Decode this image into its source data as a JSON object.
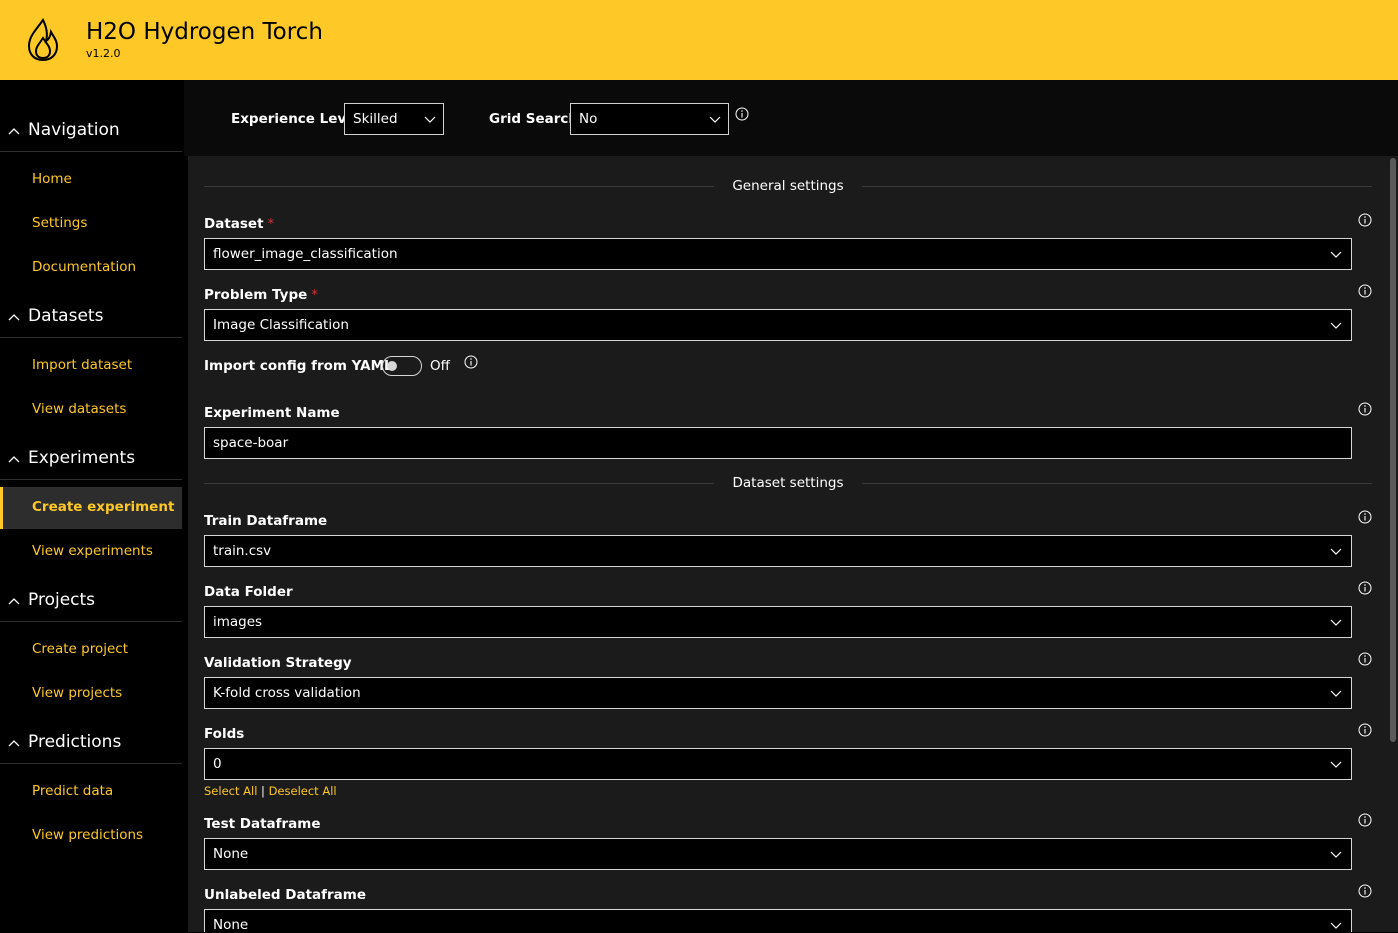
{
  "app": {
    "title": "H2O Hydrogen Torch",
    "version": "v1.2.0"
  },
  "colors": {
    "accent": "#fec827",
    "background": "#000000",
    "card": "#1b1b1b",
    "required": "#d13438"
  },
  "sidebar": {
    "groups": [
      {
        "label": "Navigation",
        "items": [
          "Home",
          "Settings",
          "Documentation"
        ]
      },
      {
        "label": "Datasets",
        "items": [
          "Import dataset",
          "View datasets"
        ]
      },
      {
        "label": "Experiments",
        "items": [
          "Create experiment",
          "View experiments"
        ]
      },
      {
        "label": "Projects",
        "items": [
          "Create project",
          "View projects"
        ]
      },
      {
        "label": "Predictions",
        "items": [
          "Predict data",
          "View predictions"
        ]
      }
    ],
    "active_item": "Create experiment"
  },
  "topbar": {
    "experience_level": {
      "label": "Experience Level",
      "value": "Skilled"
    },
    "grid_search": {
      "label": "Grid Search",
      "value": "No"
    }
  },
  "form": {
    "general_section": "General settings",
    "dataset": {
      "label": "Dataset",
      "required": "*",
      "value": "flower_image_classification"
    },
    "problem_type": {
      "label": "Problem Type",
      "required": "*",
      "value": "Image Classification"
    },
    "import_yaml": {
      "label": "Import config from YAML",
      "state": "Off"
    },
    "experiment_name": {
      "label": "Experiment Name",
      "value": "space-boar"
    },
    "dataset_section": "Dataset settings",
    "train_dataframe": {
      "label": "Train Dataframe",
      "value": "train.csv"
    },
    "data_folder": {
      "label": "Data Folder",
      "value": "images"
    },
    "validation_strategy": {
      "label": "Validation Strategy",
      "value": "K-fold cross validation"
    },
    "folds": {
      "label": "Folds",
      "value": "0",
      "select_all": "Select All",
      "separator": "|",
      "deselect_all": "Deselect All"
    },
    "test_dataframe": {
      "label": "Test Dataframe",
      "value": "None"
    },
    "unlabeled_dataframe": {
      "label": "Unlabeled Dataframe",
      "value": "None"
    }
  }
}
